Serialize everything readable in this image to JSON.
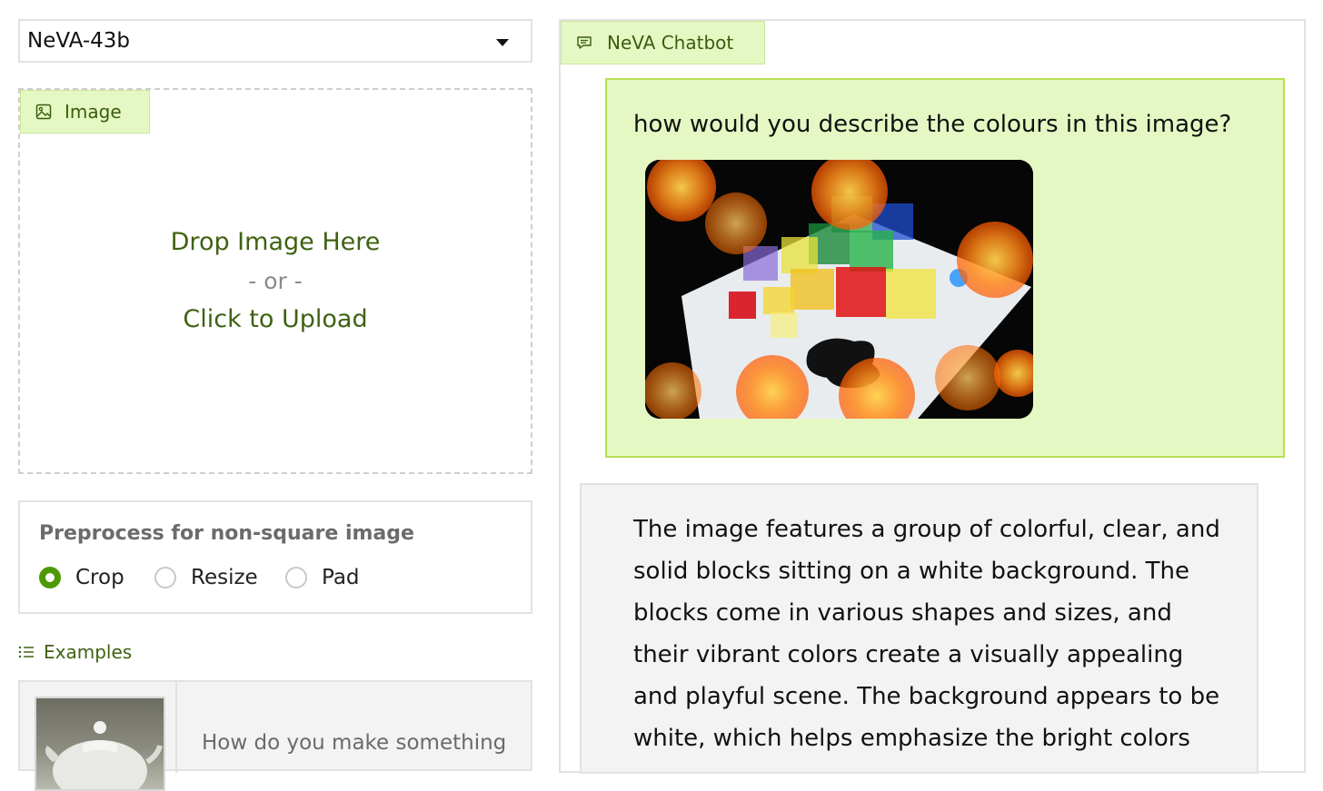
{
  "model_select": {
    "value": "NeVA-43b"
  },
  "image_upload": {
    "label": "Image",
    "drop_text": "Drop Image Here",
    "or_text": "- or -",
    "upload_text": "Click to Upload"
  },
  "preprocess": {
    "title": "Preprocess for non-square image",
    "options": [
      "Crop",
      "Resize",
      "Pad"
    ],
    "selected": "Crop"
  },
  "examples": {
    "label": "Examples",
    "items": [
      {
        "text": "How do you make something"
      }
    ]
  },
  "chatbot": {
    "label": "NeVA Chatbot",
    "user_message": "how would you describe the colours in this image?",
    "bot_message_lines": [
      "The image features a group of colorful, clear, and",
      "solid blocks sitting on a white background. The",
      "blocks come in various shapes and sizes, and",
      "their vibrant colors create a visually appealing",
      "and playful scene. The background appears to be",
      "white, which helps emphasize the bright colors"
    ]
  },
  "colors": {
    "accent_green": "#4e9a06",
    "label_bg": "#e5f8c3",
    "label_text": "#3f6212",
    "user_bubble_border": "#b5e04f"
  }
}
